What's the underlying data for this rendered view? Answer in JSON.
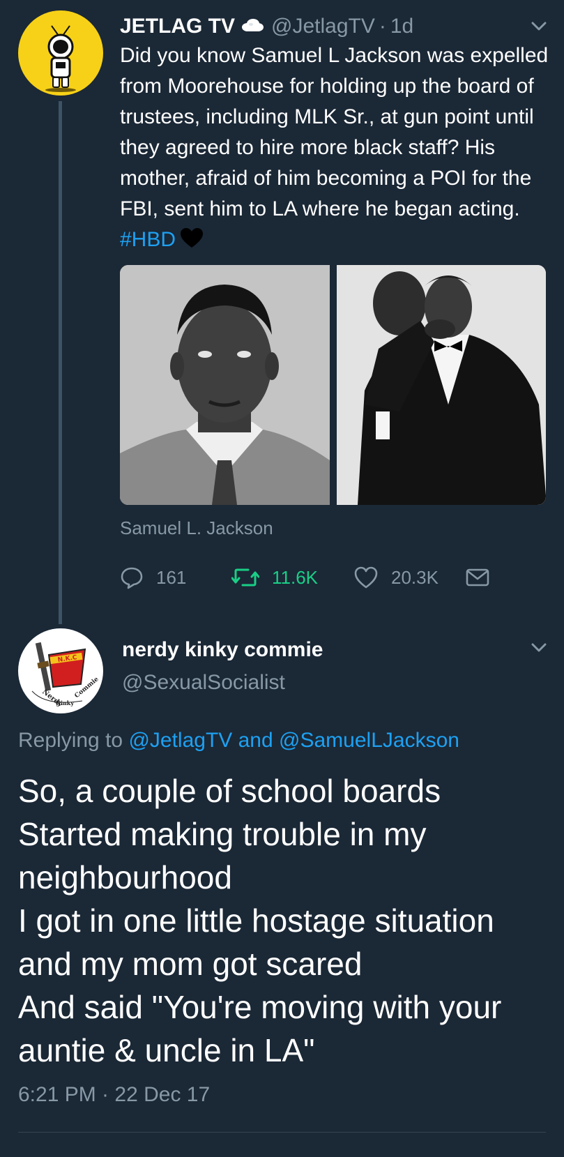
{
  "tweet1": {
    "author_name": "JETLAG TV",
    "handle": "@JetlagTV",
    "separator": "·",
    "time": "1d",
    "text_main": "Did you know Samuel L Jackson was expelled from Moorehouse for holding up the board of trustees, including MLK Sr., at gun point until they agreed to hire more black staff? His mother, afraid of him becoming a POI for the FBI, sent him to LA where he began acting.",
    "hashtag": "#HBD",
    "media_caption": "Samuel L. Jackson",
    "replies": "161",
    "retweets": "11.6K",
    "likes": "20.3K",
    "icons": [
      "cloud-emoji-icon",
      "black-heart-emoji-icon",
      "reply-icon",
      "retweet-icon",
      "like-icon",
      "message-icon",
      "chevron-down-icon"
    ],
    "colors": {
      "retweet_active": "#19cf86",
      "hashtag": "#1da1f2",
      "avatar_bg": "#f7d117"
    }
  },
  "tweet2": {
    "author_name": "nerdy kinky commie",
    "handle": "@SexualSocialist",
    "replying_prefix": "Replying to",
    "reply_target_1": "@JetlagTV",
    "reply_and": "and",
    "reply_target_2": "@SamuelLJackson",
    "avatar_text": "N.K.C",
    "avatar_ring_left": "Nerdy",
    "avatar_ring_mid": "Kinky",
    "avatar_ring_right": "Commie",
    "lines": [
      "So, a couple of school boards",
      "Started making trouble in my",
      "neighbourhood",
      "I got in one little hostage situation",
      "and my mom got scared",
      "And said \"You're moving with your",
      "auntie & uncle in LA\""
    ],
    "timestamp": "6:21 PM · 22 Dec 17"
  },
  "theme": {
    "background": "#1b2836",
    "secondary_text": "#8899a6",
    "link": "#1da1f2"
  }
}
